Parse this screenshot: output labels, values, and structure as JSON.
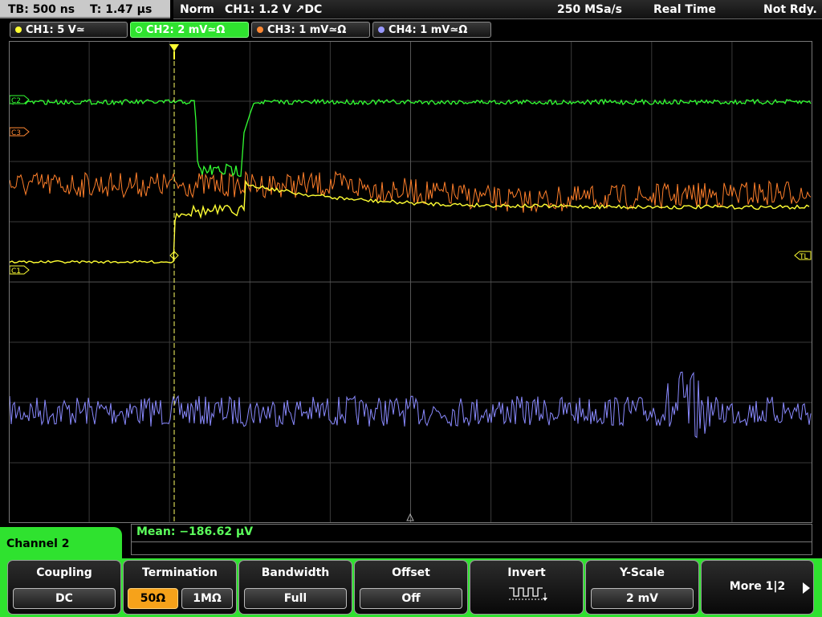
{
  "timebase": {
    "tb": "TB: 500 ns",
    "t": "T: 1.47 µs"
  },
  "status": {
    "mode": "Norm",
    "trigger": "CH1: 1.2 V ↗DC",
    "samplerate": "250 MSa/s",
    "acq": "Real Time",
    "state": "Not Rdy."
  },
  "channels": [
    {
      "label": "CH1: 5 V≃",
      "color": "#ffff33"
    },
    {
      "label": "CH2: 2 mV≃Ω",
      "color": "#33ff33"
    },
    {
      "label": "CH3: 1 mV≃Ω",
      "color": "#ff8833"
    },
    {
      "label": "CH4: 1 mV≃Ω",
      "color": "#9999ff"
    }
  ],
  "markers": {
    "c3": "C3",
    "c1": "C1",
    "c2": "C2",
    "tl": "TL"
  },
  "measurement": {
    "label": "Mean: −186.62 µV"
  },
  "panel": {
    "title": "Channel 2"
  },
  "softkeys": {
    "coupling": {
      "title": "Coupling",
      "value": "DC"
    },
    "termination": {
      "title": "Termination",
      "opt1": "50Ω",
      "opt2": "1MΩ"
    },
    "bandwidth": {
      "title": "Bandwidth",
      "value": "Full"
    },
    "offset": {
      "title": "Offset",
      "value": "Off"
    },
    "invert": {
      "title": "Invert"
    },
    "yscale": {
      "title": "Y-Scale",
      "value": "2 mV"
    },
    "more": {
      "label": "More 1|2"
    }
  }
}
